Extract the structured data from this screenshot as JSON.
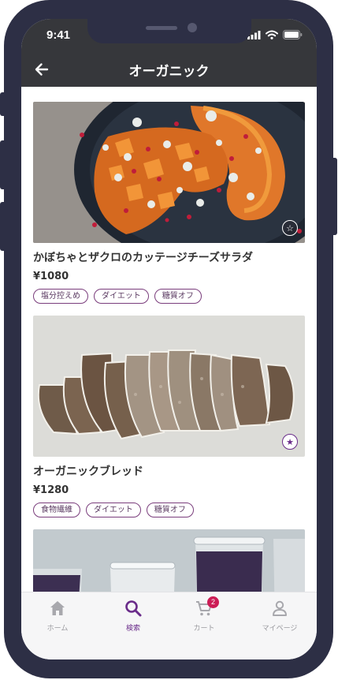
{
  "status": {
    "time": "9:41"
  },
  "header": {
    "title": "オーガニック"
  },
  "products": [
    {
      "name": "かぼちゃとザクロのカッテージチーズサラダ",
      "price": "¥1080",
      "tags": [
        "塩分控えめ",
        "ダイエット",
        "糖質オフ"
      ],
      "favorited": false
    },
    {
      "name": "オーガニックブレッド",
      "price": "¥1280",
      "tags": [
        "食物繊維",
        "ダイエット",
        "糖質オフ"
      ],
      "favorited": true
    }
  ],
  "tabbar": {
    "items": [
      {
        "label": "ホーム",
        "icon": "home-icon"
      },
      {
        "label": "検索",
        "icon": "search-icon",
        "active": true
      },
      {
        "label": "カート",
        "icon": "cart-icon",
        "badge": "2"
      },
      {
        "label": "マイページ",
        "icon": "person-icon"
      }
    ]
  },
  "colors": {
    "accent": "#6a2c8a",
    "header": "#36373b",
    "badge": "#cc1d56",
    "frame": "#2d2f45"
  }
}
